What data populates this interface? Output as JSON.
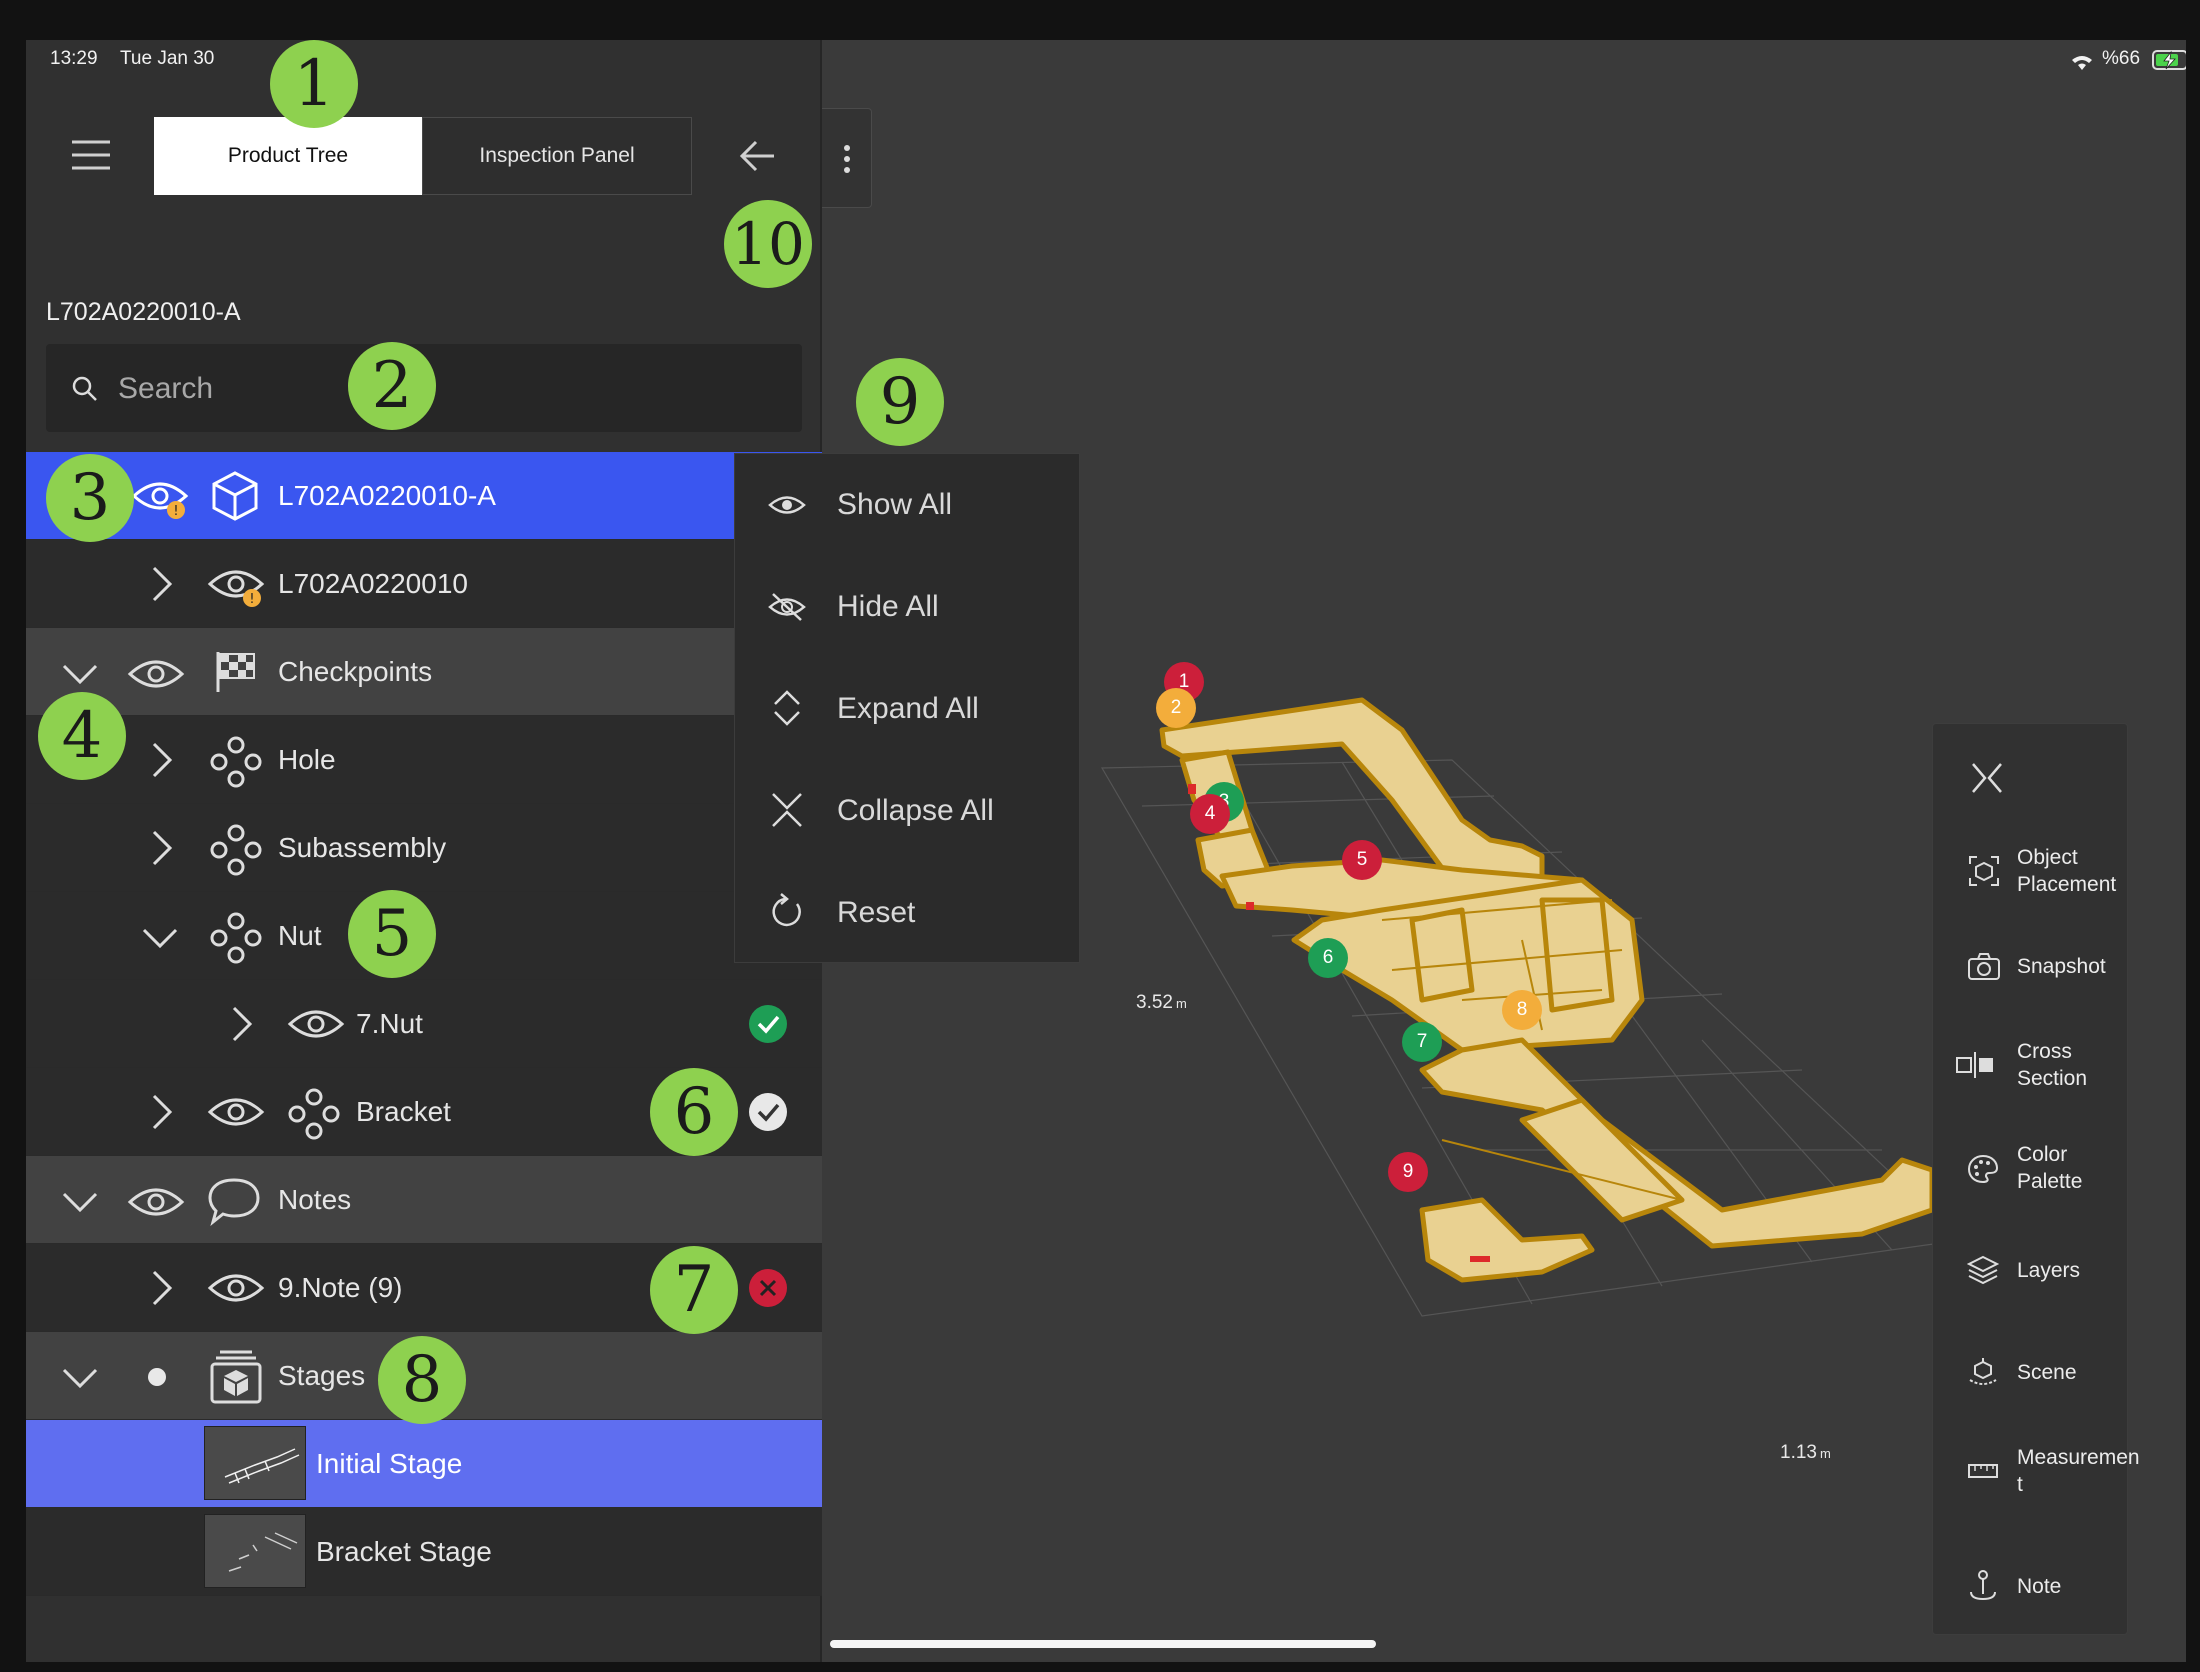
{
  "status_bar": {
    "time": "13:29",
    "date": "Tue Jan 30",
    "battery": "%66"
  },
  "header": {
    "tabs": [
      {
        "label": "Product Tree",
        "active": true
      },
      {
        "label": "Inspection Panel",
        "active": false
      }
    ]
  },
  "model_id": "L702A0220010-A",
  "search": {
    "placeholder": "Search"
  },
  "tree": {
    "root": "L702A0220010-A",
    "assembly": "L702A0220010",
    "checkpoints": "Checkpoints",
    "hole": "Hole",
    "subassembly": "Subassembly",
    "nut": "Nut",
    "nut_item": "7.Nut",
    "bracket": "Bracket",
    "notes": "Notes",
    "note_item": "9.Note (9)",
    "stages": "Stages",
    "stage_initial": "Initial Stage",
    "stage_bracket": "Bracket Stage"
  },
  "context_menu": {
    "items": [
      {
        "label": "Show All",
        "icon": "eye-icon"
      },
      {
        "label": "Hide All",
        "icon": "eye-off-icon"
      },
      {
        "label": "Expand All",
        "icon": "expand-icon"
      },
      {
        "label": "Collapse All",
        "icon": "collapse-icon"
      },
      {
        "label": "Reset",
        "icon": "reset-icon"
      }
    ]
  },
  "viewport": {
    "dim_left": "3.52",
    "dim_right": "1.13",
    "unit": "m",
    "pins": [
      {
        "n": "1",
        "status": "failed"
      },
      {
        "n": "2",
        "status": "pending"
      },
      {
        "n": "3",
        "status": "passed"
      },
      {
        "n": "4",
        "status": "failed"
      },
      {
        "n": "5",
        "status": "failed"
      },
      {
        "n": "6",
        "status": "passed"
      },
      {
        "n": "7",
        "status": "passed"
      },
      {
        "n": "8",
        "status": "pending"
      },
      {
        "n": "9",
        "status": "failed"
      }
    ]
  },
  "toolbar": {
    "items": [
      {
        "label": "Object Placement"
      },
      {
        "label": "Snapshot"
      },
      {
        "label": "Cross Section"
      },
      {
        "label": "Color Palette"
      },
      {
        "label": "Layers"
      },
      {
        "label": "Scene"
      },
      {
        "label": "Measuremen t"
      },
      {
        "label": "Note"
      }
    ]
  },
  "callouts": [
    "1",
    "2",
    "3",
    "4",
    "5",
    "6",
    "7",
    "8",
    "9",
    "10"
  ],
  "colors": {
    "accent": "#3a56f0",
    "selected": "#5f6ef0",
    "callout": "#8ed14f",
    "pass": "#1e9e55",
    "fail": "#cc1f3a",
    "pending": "#f3ad3b",
    "model": "#e9d191"
  }
}
